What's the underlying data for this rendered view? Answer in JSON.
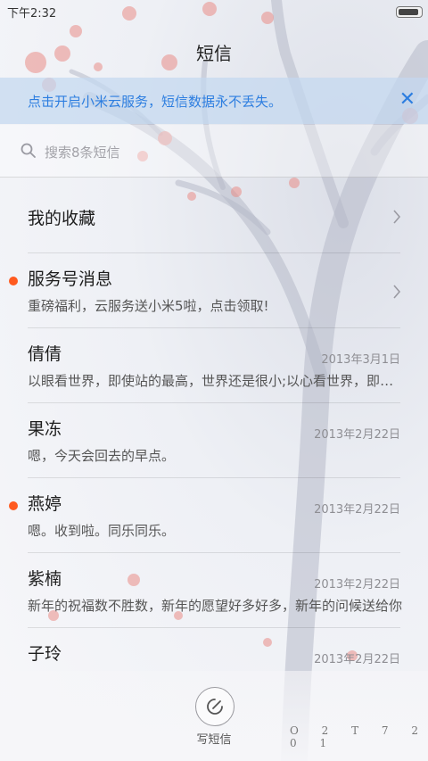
{
  "status_bar": {
    "time": "下午2:32"
  },
  "header": {
    "title": "短信"
  },
  "banner": {
    "text": "点击开启小米云服务，短信数据永不丢失。",
    "close_glyph": "✕"
  },
  "search": {
    "placeholder": "搜索8条短信"
  },
  "favorites": {
    "label": "我的收藏"
  },
  "conversations": [
    {
      "name": "服务号消息",
      "preview": "重磅福利，云服务送小米5啦，点击领取!",
      "date": "",
      "unread": true
    },
    {
      "name": "倩倩",
      "preview": "以眼看世界，即使站的最高，世界还是很小;以心看世界，即使站的最低，世界也很大",
      "date": "2013年3月1日",
      "unread": false
    },
    {
      "name": "果冻",
      "preview": "嗯，今天会回去的早点。",
      "date": "2013年2月22日",
      "unread": false
    },
    {
      "name": "燕婷",
      "preview": "嗯。收到啦。同乐同乐。",
      "date": "2013年2月22日",
      "unread": true
    },
    {
      "name": "紫楠",
      "preview": "新年的祝福数不胜数，新年的愿望好多好多，新年的问候送给你",
      "date": "2013年2月22日",
      "unread": false
    },
    {
      "name": "子玲",
      "preview": "",
      "date": "2013年2月22日",
      "unread": false
    }
  ],
  "compose": {
    "label": "写短信"
  },
  "watermark": "O 2 T 7 2 0 1",
  "colors": {
    "accent": "#2d7ee0",
    "unread_dot": "#ff5a1f",
    "banner_bg": "#c4d8f0"
  },
  "icons": {
    "search": "search-icon",
    "chevron": "chevron-right-icon",
    "compose": "compose-icon",
    "close": "close-icon"
  }
}
